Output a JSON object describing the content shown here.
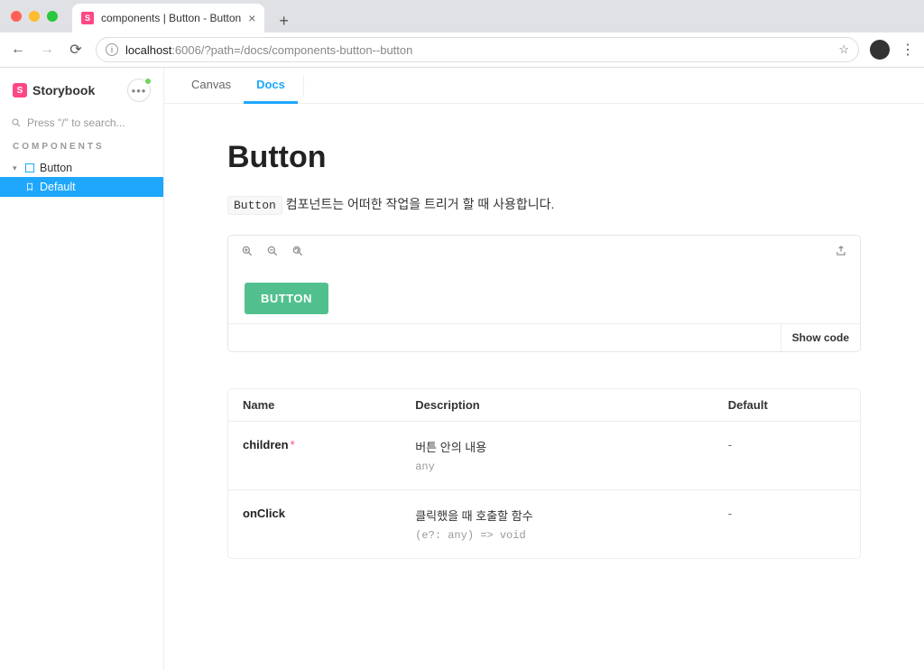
{
  "browser": {
    "tab_title": "components | Button - Button",
    "url_host": "localhost",
    "url_port_path": ":6006/?path=/docs/components-button--button"
  },
  "sidebar": {
    "brand": "Storybook",
    "search_placeholder": "Press \"/\" to search...",
    "section_label": "COMPONENTS",
    "tree": {
      "component": "Button",
      "story": "Default"
    }
  },
  "doc_tabs": {
    "canvas": "Canvas",
    "docs": "Docs"
  },
  "doc": {
    "title": "Button",
    "code_word": "Button",
    "desc_suffix": " 컴포넌트는 어떠한 작업을 트리거 할 때 사용합니다."
  },
  "preview": {
    "button_label": "BUTTON",
    "show_code": "Show code"
  },
  "args": {
    "head": {
      "name": "Name",
      "desc": "Description",
      "def": "Default"
    },
    "rows": [
      {
        "name": "children",
        "required": "*",
        "desc": "버튼 안의 내용",
        "type": "any",
        "def": "-"
      },
      {
        "name": "onClick",
        "required": "",
        "desc": "클릭했을 때 호출할 함수",
        "type": "(e?: any) => void",
        "def": "-"
      }
    ]
  }
}
